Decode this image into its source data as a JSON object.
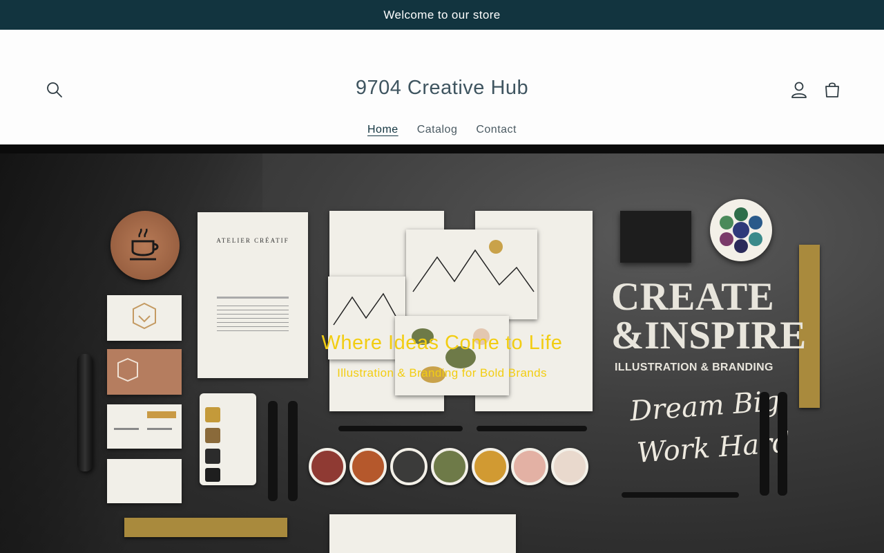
{
  "announcement": {
    "text": "Welcome to our store"
  },
  "header": {
    "logo": "9704 Creative Hub",
    "search_icon": "search-icon",
    "account_icon": "user-icon",
    "cart_icon": "bag-icon"
  },
  "nav": {
    "items": [
      {
        "label": "Home",
        "active": true
      },
      {
        "label": "Catalog",
        "active": false
      },
      {
        "label": "Contact",
        "active": false
      }
    ]
  },
  "hero": {
    "heading": "Where Ideas Come to Life",
    "subheading": "Illustration & Branding for Bold Brands",
    "image": {
      "letterhead_title": "ATELIER CRÉATIF",
      "create": "CREATE",
      "inspire": "&INSPIRE",
      "tagline": "ILLUSTRATION & BRANDING",
      "script_1": "Dream Big",
      "script_2": "Work Hard"
    },
    "colors": {
      "heading": "#f2cd12",
      "swatches": [
        "#8f3a33",
        "#b5582c",
        "#3b3b3a",
        "#6e7a48",
        "#d19a32",
        "#e3b1a4",
        "#e9d9cd"
      ],
      "palette_wells": [
        "#c49a3a",
        "#8a6a3a",
        "#2b2b2b",
        "#1e1e1e"
      ]
    }
  },
  "theme": {
    "announcement_bg": "#12343f",
    "text_color": "#3f5560"
  }
}
